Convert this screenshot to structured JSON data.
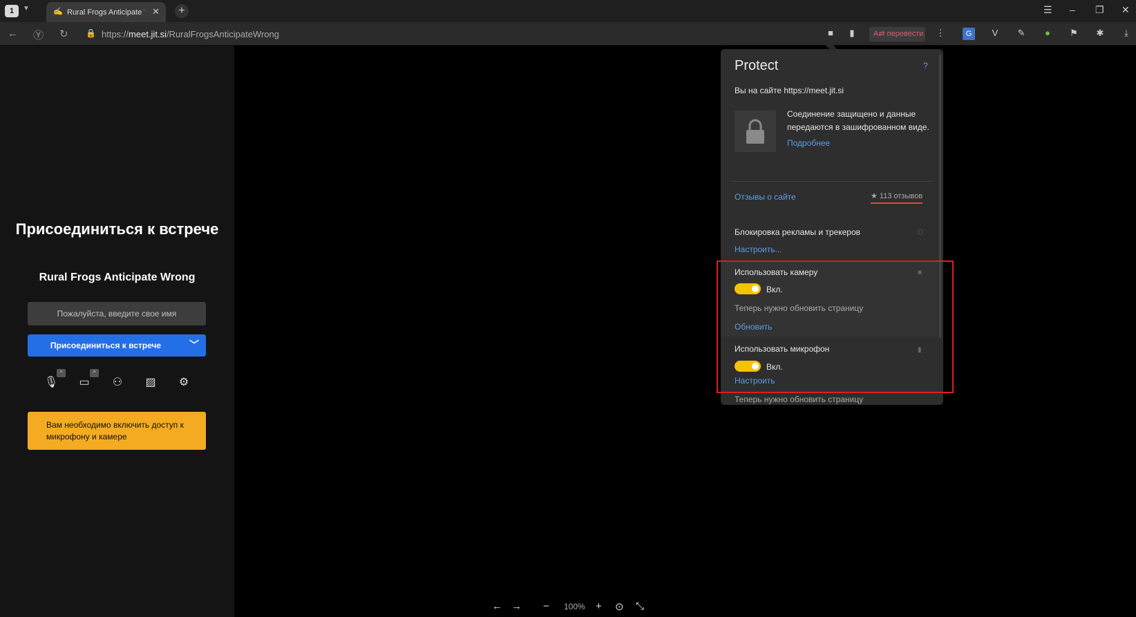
{
  "browser": {
    "tab_counter": "1",
    "tab_title": "Rural Frogs Anticipate W",
    "url_host": "meet.jit.si",
    "url_scheme": "https://",
    "url_path": "/RuralFrogsAnticipateWrong",
    "translate_label": "перевести"
  },
  "prejoin": {
    "title": "Присоединиться к встрече",
    "meeting_name": "Rural Frogs Anticipate Wrong",
    "name_placeholder": "Пожалуйста, введите свое имя",
    "join_label": "Присоединиться к встрече",
    "warning": "Вам необходимо включить доступ к микрофону и камере"
  },
  "zoom": {
    "level": "100%"
  },
  "protect": {
    "title": "Protect",
    "help": "?",
    "site_line": "Вы на сайте https://meet.jit.si",
    "connection_text": "Соединение защищено и данные передаются в зашифрованном виде.",
    "more_link": "Подробнее",
    "reviews_link": "Отзывы о сайте",
    "rating": "★ 113 отзывов",
    "adblock_title": "Блокировка рекламы и трекеров",
    "adblock_link": "Настроить...",
    "camera_title": "Использовать камеру",
    "camera_state": "Вкл.",
    "camera_hint": "Теперь нужно обновить страницу",
    "camera_link": "Обновить",
    "mic_title": "Использовать микрофон",
    "mic_state": "Вкл.",
    "mic_link": "Настроить",
    "mic_hint": "Теперь нужно обновить страницу",
    "camera_on": true,
    "mic_on": true
  },
  "colors": {
    "accent_blue": "#246fe5",
    "warning_yellow": "#f4ab21",
    "toggle_yellow": "#f4c300",
    "highlight_red": "#e11c24"
  }
}
